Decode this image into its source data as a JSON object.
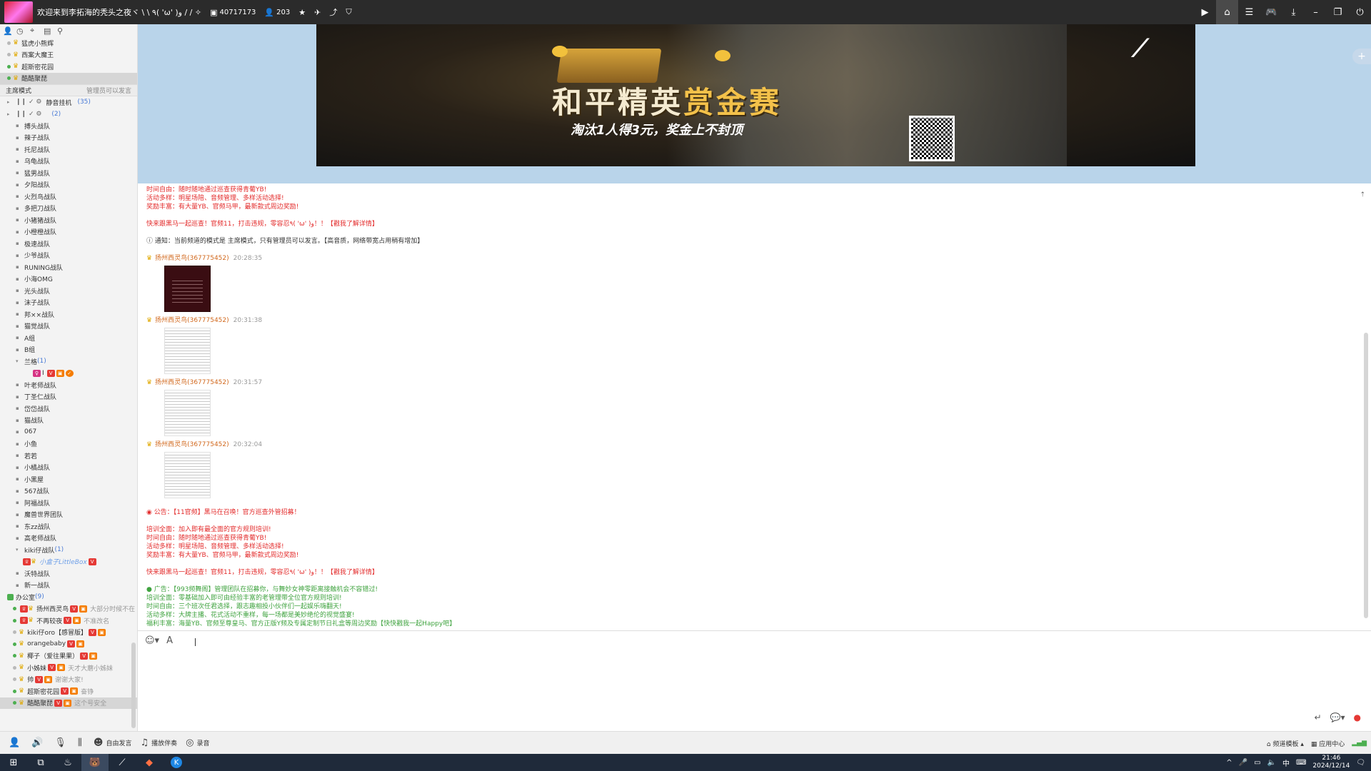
{
  "titlebar": {
    "title": "欢迎来到李拓海的秃头之夜ヾ \\ \\ ٩( 'ω' )و / / ✧",
    "channel_id": "40717173",
    "online_count": "203"
  },
  "left": {
    "top_items": [
      {
        "label": "猛虎小熊辉",
        "online": false
      },
      {
        "label": "西案大魔王",
        "online": false
      },
      {
        "label": "超斯密花园",
        "online": true
      },
      {
        "label": "酷酷聚琵",
        "online": true,
        "selected": true
      }
    ],
    "mode": {
      "label": "主席模式",
      "right": "管理员可以发言"
    },
    "header_rows": [
      {
        "label": "静音挂机",
        "count": "(35)"
      },
      {
        "label": "",
        "count": "(2)"
      }
    ],
    "groups": [
      "搏头战队",
      "辣子战队",
      "托尼战队",
      "乌龟战队",
      "猛男战队",
      "夕阳战队",
      "火烈鸟战队",
      "多把刀战队",
      "小猪猪战队",
      "小橙橙战队",
      "极速战队",
      "少爷战队",
      "RUNING战队",
      "小海OMG",
      "光头战队",
      "沫子战队",
      "邦××战队",
      "猫觉战队",
      "A组",
      "B组"
    ],
    "lanmu": {
      "label": "兰格",
      "count": "(1)",
      "member": "I"
    },
    "groups2": [
      "叶老师战队",
      "丁圣仁战队",
      "岱岱战队",
      "猫战队",
      "067",
      "小鱼",
      "若若",
      "小橘战队",
      "小黑屋",
      "567战队",
      "阿福战队",
      "魔兽世界团队",
      "东zz战队",
      "高老师战队"
    ],
    "kiki": {
      "label": "kiki仔战队",
      "count": "(1)",
      "member": "小盒子LittleBox"
    },
    "groups3": [
      "沃特战队",
      "新一战队"
    ],
    "office": {
      "label": "办公室",
      "count": "(9)"
    },
    "members": [
      {
        "name": "扬州西灵鸟",
        "note": "大部分时候不在",
        "online": true
      },
      {
        "name": "不再较夜",
        "note": "不准改名",
        "online": true
      },
      {
        "name": "kiki仔oro【感冒版】",
        "note": "",
        "online": false
      },
      {
        "name": "orangebaby",
        "note": "",
        "online": true
      },
      {
        "name": "椰子（爱往果果）",
        "note": "",
        "online": true
      },
      {
        "name": "小姊妹",
        "note": "天才大蘑小姊妹",
        "online": false
      },
      {
        "name": "帅",
        "note": "谢谢大家!",
        "online": false
      },
      {
        "name": "超斯密花园",
        "note": "奋铮",
        "online": true
      },
      {
        "name": "酷酷聚琵",
        "note": "这个号安全",
        "online": true
      }
    ]
  },
  "banner": {
    "title_white": "和平精英",
    "title_gold": "赏金赛",
    "subtitle": "淘汰1人得3元，奖金上不封顶"
  },
  "chat": {
    "intro_lines": [
      "时间自由：随时随地通过巡查获得青葡YB!",
      "活动多样：明星场陪、音频管理、多样活动选择!",
      "奖励丰富：有大量YB、官频马甲，最新款式周边奖励!"
    ],
    "recruit_line": "快来跟黑马一起巡查！官频11，打击违规，零容忍٩( 'ω' )و！！【戳我了解详情】",
    "notice": "通知：当前频道的模式是 主席模式，只有管理员可以发言。【高音质，网络带宽占用稍有增加】",
    "messages": [
      {
        "name": "扬州西灵鸟(367775452)",
        "time": "20:28:35",
        "img": "dark"
      },
      {
        "name": "扬州西灵鸟(367775452)",
        "time": "20:31:38",
        "img": "doc"
      },
      {
        "name": "扬州西灵鸟(367775452)",
        "time": "20:31:57",
        "img": "doc"
      },
      {
        "name": "扬州西灵鸟(367775452)",
        "time": "20:32:04",
        "img": "doc"
      }
    ],
    "announce": "公告：【11官频】黑马在召唤！官方巡查外管招募！",
    "announce_lines": [
      "培训全面：加入即有最全面的官方规则培训!",
      "时间自由：随时随地通过巡查获得青葡YB!",
      "活动多样：明星场陪、音频管理、多样活动选择!",
      "奖励丰富：有大量YB、官频马甲，最新款式周边奖励!"
    ],
    "recruit_line2": "快来跟黑马一起巡查！官频11，打击违规，零容忍٩( 'ω' )و！！【戳我了解详情】",
    "ad_title": "广告：【993频舞阁】管理团队在招募你，与舞妙女神零距离接触机会不容错过!",
    "ad_lines": [
      "培训全面：零基础加入即可由经验丰富的老管理带全位官方规则培训!",
      "时间自由：三个班次任君选择，跟志趣相投小伙伴们一起娱乐嗨翻天!",
      "活动多样：大牌主播、花式活动不重样，每一场都是美妙绝伦的视觉盛宴!",
      "福利丰富：海量YB、官频至尊皇马、官方正版Y频及专属定制节日礼盒等周边奖励【快快戳我一起Happy吧】"
    ]
  },
  "statusbar": {
    "free_speak": "自由发言",
    "play_music": "播放伴奏",
    "record": "录音",
    "channel_mode": "频道模板",
    "app_center": "应用中心"
  },
  "taskbar": {
    "time": "21:46",
    "date": "2024/12/14",
    "ime": "中"
  }
}
